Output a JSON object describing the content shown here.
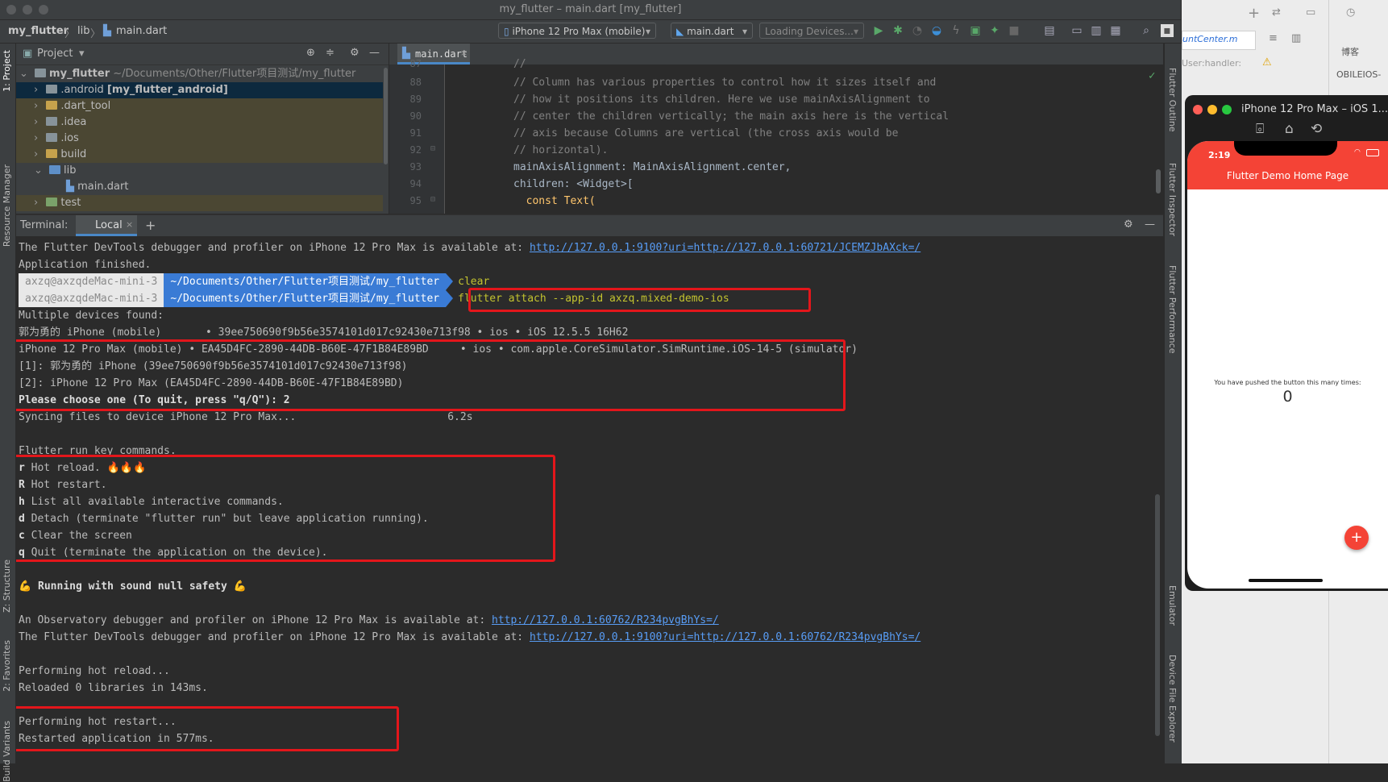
{
  "window": {
    "title": "my_flutter – main.dart [my_flutter]"
  },
  "breadcrumb": {
    "project": "my_flutter",
    "folder": "lib",
    "file": "main.dart"
  },
  "toolbar": {
    "device": "iPhone 12 Pro Max (mobile)",
    "config": "main.dart",
    "loading": "Loading Devices..."
  },
  "project_panel": {
    "title": "Project",
    "root": "my_flutter",
    "root_path": "~/Documents/Other/Flutter项目测试/my_flutter",
    "items": [
      {
        "label": ".android",
        "extra": "[my_flutter_android]"
      },
      {
        "label": ".dart_tool"
      },
      {
        "label": ".idea"
      },
      {
        "label": ".ios"
      },
      {
        "label": "build"
      },
      {
        "label": "lib"
      },
      {
        "label": "main.dart"
      },
      {
        "label": "test"
      }
    ]
  },
  "editor": {
    "tab": "main.dart",
    "line_numbers": [
      "87",
      "88",
      "89",
      "90",
      "91",
      "92",
      "93",
      "94",
      "95"
    ],
    "lines": [
      "//",
      "// Column has various properties to control how it sizes itself and",
      "// how it positions its children. Here we use mainAxisAlignment to",
      "// center the children vertically; the main axis here is the vertical",
      "// axis because Columns are vertical (the cross axis would be",
      "// horizontal).",
      "mainAxisAlignment: MainAxisAlignment.center,",
      "children: <Widget>[",
      "  const Text("
    ]
  },
  "left_tabs": [
    "1: Project",
    "Resource Manager",
    "Z: Structure",
    "2: Favorites",
    "Build Variants"
  ],
  "right_tabs": [
    "Flutter Outline",
    "Flutter Inspector",
    "Flutter Performance",
    "Emulator",
    "Device File Explorer"
  ],
  "terminal": {
    "label": "Terminal:",
    "tab": "Local",
    "prompt_user": "axzq@axzqdeMac-mini-3",
    "prompt_path": "~/Documents/Other/Flutter项目测试/my_flutter",
    "cmd_clear": "clear",
    "cmd_attach": "flutter attach --app-id axzq.mixed-demo-ios",
    "line_devtools_1": "The Flutter DevTools debugger and profiler on iPhone 12 Pro Max is available at: ",
    "link_devtools_1": "http://127.0.0.1:9100?uri=http://127.0.0.1:60721/JCEMZJbAXck=/",
    "line_app_finished": "Application finished.",
    "line_multiple": "Multiple devices found:",
    "line_dev1": "郭为勇的 iPhone (mobile)       • 39ee750690f9b56e3574101d017c92430e713f98 • ios • iOS 12.5.5 16H62",
    "line_dev2": "iPhone 12 Pro Max (mobile) • EA45D4FC-2890-44DB-B60E-47F1B84E89BD     • ios • com.apple.CoreSimulator.SimRuntime.iOS-14-5 (simulator)",
    "line_opt1": "[1]: 郭为勇的 iPhone (39ee750690f9b56e3574101d017c92430e713f98)",
    "line_opt2": "[2]: iPhone 12 Pro Max (EA45D4FC-2890-44DB-B60E-47F1B84E89BD)",
    "line_choose": "Please choose one (To quit, press \"q/Q\"): 2",
    "line_syncing": "Syncing files to device iPhone 12 Pro Max...                        6.2s",
    "line_keycmds": "Flutter run key commands.",
    "cmd_r_key": "r",
    "cmd_r_text": " Hot reload. 🔥🔥🔥",
    "cmd_R_key": "R",
    "cmd_R_text": " Hot restart.",
    "cmd_h_key": "h",
    "cmd_h_text": " List all available interactive commands.",
    "cmd_d_key": "d",
    "cmd_d_text": " Detach (terminate \"flutter run\" but leave application running).",
    "cmd_c_key": "c",
    "cmd_c_text": " Clear the screen",
    "cmd_q_key": "q",
    "cmd_q_text": " Quit (terminate the application on the device).",
    "line_null_safety": "💪 Running with sound null safety 💪",
    "line_observatory": "An Observatory debugger and profiler on iPhone 12 Pro Max is available at: ",
    "link_observatory": "http://127.0.0.1:60762/R234pvgBhYs=/",
    "line_devtools_2": "The Flutter DevTools debugger and profiler on iPhone 12 Pro Max is available at: ",
    "link_devtools_2": "http://127.0.0.1:9100?uri=http://127.0.0.1:60762/R234pvgBhYs=/",
    "line_hot_reload": "Performing hot reload...",
    "line_reloaded": "Reloaded 0 libraries in 143ms.",
    "line_hot_restart": "Performing hot restart...",
    "line_restarted": "Restarted application in 577ms."
  },
  "xcode": {
    "file_tab": "untCenter.m",
    "code_hint": "User:handler:",
    "side_text_1": "博客",
    "side_text_2": "OBILEIOS-"
  },
  "simulator": {
    "title": "iPhone 12 Pro Max – iOS 1...",
    "time": "2:19",
    "app_bar_title": "Flutter Demo Home Page",
    "counter_label": "You have pushed the button this many times:",
    "counter_value": "0",
    "fab_label": "+"
  },
  "colors": {
    "accent_red": "#e3161b",
    "flutter_bar": "#f44336",
    "link": "#589df6"
  }
}
